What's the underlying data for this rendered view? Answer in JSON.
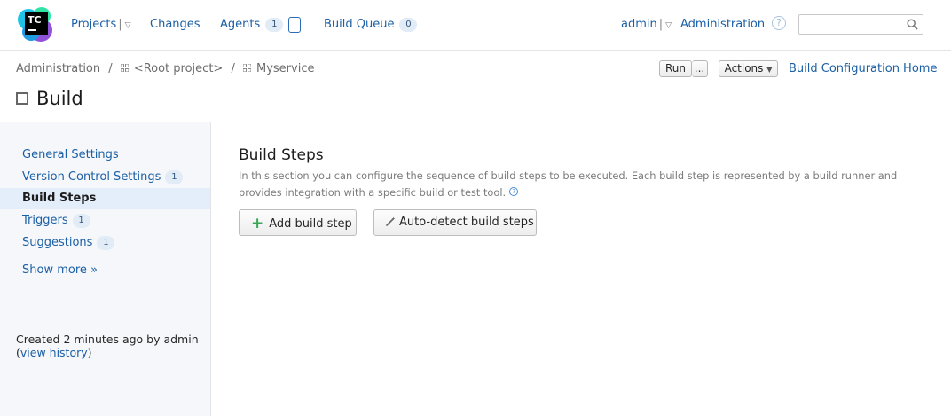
{
  "app": {
    "logo_text": "TC"
  },
  "nav": {
    "projects": "Projects",
    "changes": "Changes",
    "agents": "Agents",
    "agents_count": "1",
    "build_queue": "Build Queue",
    "build_queue_count": "0",
    "user": "admin",
    "administration": "Administration",
    "search_placeholder": ""
  },
  "breadcrumb": {
    "items": [
      "Administration",
      "<Root project>",
      "Myservice"
    ],
    "separator": "/"
  },
  "header": {
    "run": "Run",
    "run_more": "...",
    "actions": "Actions",
    "build_config_home": "Build Configuration Home",
    "title": "Build"
  },
  "sidebar": {
    "items": [
      {
        "label": "General Settings",
        "count": ""
      },
      {
        "label": "Version Control Settings",
        "count": "1"
      },
      {
        "label": "Build Steps",
        "count": ""
      },
      {
        "label": "Triggers",
        "count": "1"
      },
      {
        "label": "Suggestions",
        "count": "1"
      }
    ],
    "show_more": "Show more »",
    "footer_text": "Created 2 minutes ago by admin",
    "footer_open": "(",
    "footer_link": "view history",
    "footer_close": ")"
  },
  "main": {
    "title": "Build Steps",
    "description": "In this section you can configure the sequence of build steps to be executed. Each build step is represented by a build runner and provides integration with a specific build or test tool.",
    "help": "?",
    "add_step": "Add build step",
    "auto_detect": "Auto-detect build steps"
  },
  "colors": {
    "link": "#1b5fa5",
    "active_bg": "#e4eefa",
    "sidebar_bg": "#f5f7fa",
    "plus_green": "#3aa654"
  }
}
